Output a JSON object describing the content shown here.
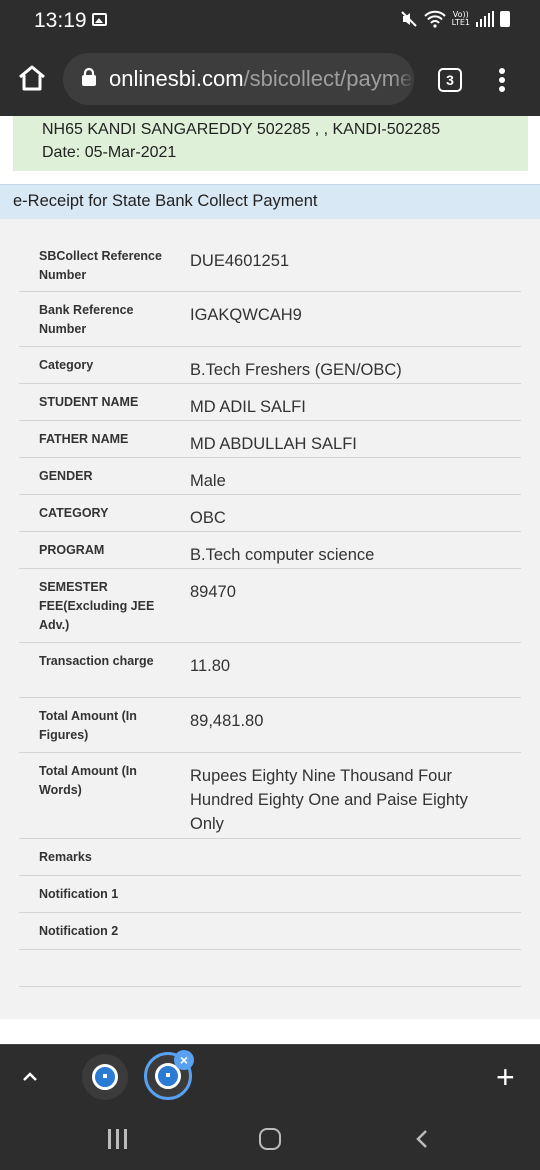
{
  "status_bar": {
    "time": "13:19",
    "volte": "Vo))",
    "lte": "LTE1",
    "icons": [
      "gallery-icon",
      "mute-icon",
      "wifi-icon",
      "signal-icon",
      "battery-icon"
    ]
  },
  "browser": {
    "url_domain": "onlinesbi.com",
    "url_path": "/sbicollect/payme",
    "tab_count": "3",
    "icons": [
      "home-icon",
      "lock-icon",
      "tabs-icon",
      "menu-icon"
    ]
  },
  "page": {
    "address_line": "NH65 KANDI SANGAREDDY 502285 , , KANDI-502285",
    "date_line": "Date: 05-Mar-2021",
    "receipt_title": "e-Receipt for State Bank Collect Payment",
    "rows": [
      {
        "label": "SBCollect Reference Number",
        "value": "DUE4601251"
      },
      {
        "label": "Bank Reference Number",
        "value": "IGAKQWCAH9"
      },
      {
        "label": "Category",
        "value": "B.Tech Freshers (GEN/OBC)"
      },
      {
        "label": "STUDENT NAME",
        "value": "MD ADIL SALFI"
      },
      {
        "label": "FATHER NAME",
        "value": "MD ABDULLAH SALFI"
      },
      {
        "label": "GENDER",
        "value": "Male"
      },
      {
        "label": "CATEGORY",
        "value": "OBC"
      },
      {
        "label": "PROGRAM",
        "value": "B.Tech computer science"
      },
      {
        "label": "SEMESTER FEE(Excluding JEE Adv.)",
        "value": "89470"
      },
      {
        "label": "Transaction charge",
        "value": "11.80"
      },
      {
        "label": "Total Amount (In Figures)",
        "value": "89,481.80"
      },
      {
        "label": "Total Amount (In Words)",
        "value": "Rupees Eighty Nine Thousand Four Hundred Eighty One and Paise Eighty Only"
      },
      {
        "label": "Remarks",
        "value": ""
      },
      {
        "label": "Notification 1",
        "value": ""
      },
      {
        "label": "Notification 2",
        "value": ""
      }
    ]
  },
  "bottom_bar": {
    "icons": [
      "chevron-up-icon",
      "sbi-tab-icon",
      "sbi-tab-active-icon",
      "close-icon",
      "plus-icon"
    ],
    "close_glyph": "×",
    "plus_glyph": "+"
  },
  "nav_bar": {
    "icons": [
      "recent-apps-icon",
      "home-nav-icon",
      "back-icon"
    ]
  },
  "colors": {
    "chrome_bar": "#2d2d2d",
    "url_bar": "#3d3d3d",
    "address_bg": "#dff0d8",
    "header_bg": "#d9e8f5",
    "table_bg": "#f2f2f2",
    "accent_blue": "#5aa0f0"
  }
}
